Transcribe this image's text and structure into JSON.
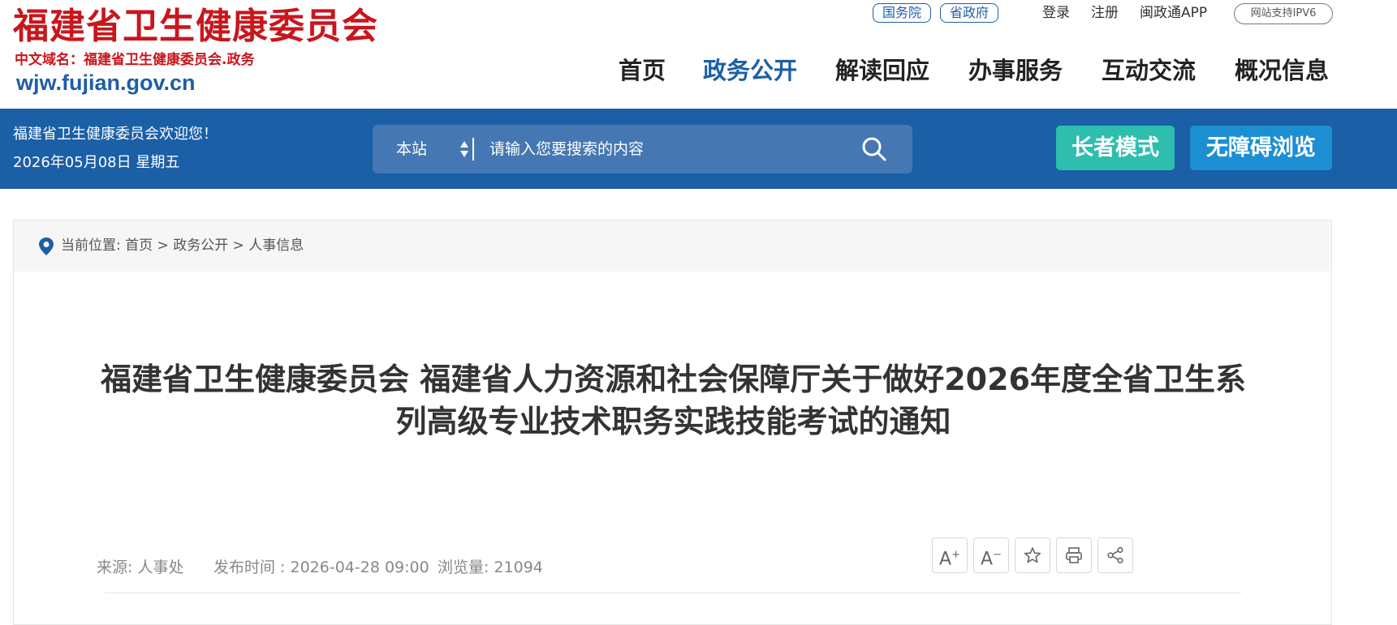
{
  "header": {
    "logo_title": "福建省卫生健康委员会",
    "logo_subtitle": "中文域名：福建省卫生健康委员会.政务",
    "logo_url": "wjw.fujian.gov.cn",
    "top_links": {
      "guowuyuan": "国务院",
      "shengzhengfu": "省政府",
      "login": "登录",
      "register": "注册",
      "app": "闽政通APP",
      "ipv6": "网站支持IPV6"
    },
    "nav": [
      {
        "label": "首页",
        "active": false
      },
      {
        "label": "政务公开",
        "active": true
      },
      {
        "label": "解读回应",
        "active": false
      },
      {
        "label": "办事服务",
        "active": false
      },
      {
        "label": "互动交流",
        "active": false
      },
      {
        "label": "概况信息",
        "active": false
      }
    ]
  },
  "bar": {
    "welcome": "福建省卫生健康委员会欢迎您！",
    "date": "2026年05月08日 星期五",
    "search": {
      "scope": "本站",
      "placeholder": "请输入您要搜索的内容"
    },
    "elder_mode": "长者模式",
    "accessible": "无障碍浏览"
  },
  "breadcrumb": {
    "prefix": "当前位置:",
    "items": [
      "首页",
      "政务公开",
      "人事信息"
    ],
    "separator": ">"
  },
  "article": {
    "title": "福建省卫生健康委员会 福建省人力资源和社会保障厅关于做好2026年度全省卫生系列高级专业技术职务实践技能考试的通知",
    "source_label": "来源:",
    "source": "人事处",
    "publish_label": "发布时间 :",
    "publish_time": "2026-04-28 09:00",
    "views_label": "浏览量:",
    "views": "21094",
    "tools": {
      "font_larger": "A",
      "font_smaller": "A",
      "plus": "+",
      "minus": "−"
    }
  },
  "colors": {
    "brand_red": "#c8161d",
    "brand_blue": "#1b5fa7",
    "elder_green": "#2dbeae",
    "access_blue": "#1c8fd2"
  }
}
